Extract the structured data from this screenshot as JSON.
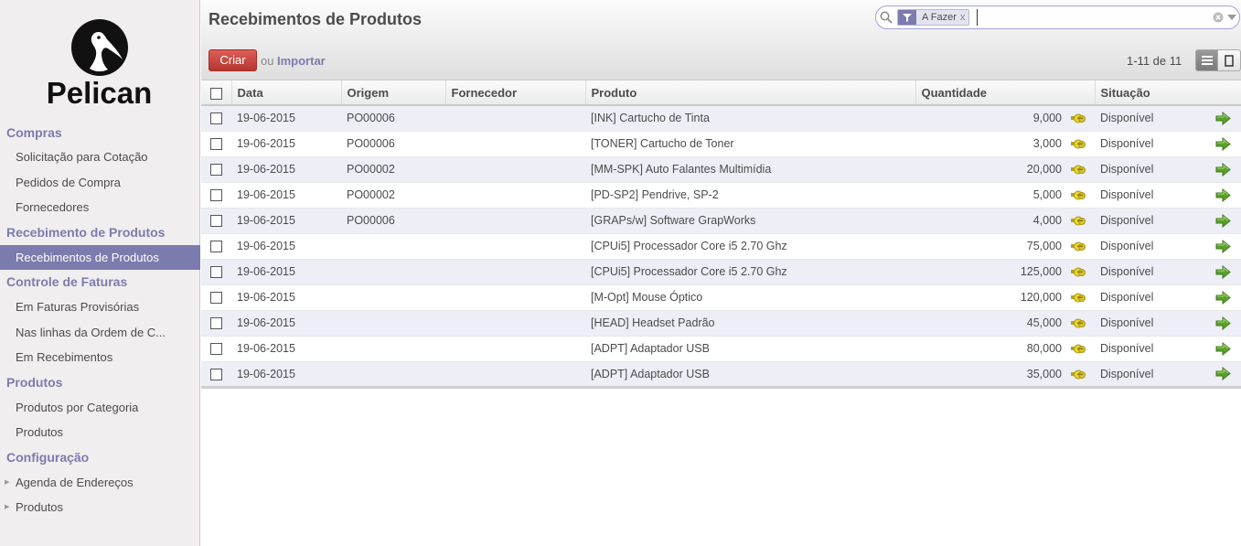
{
  "brand": {
    "name": "Pelican"
  },
  "sidebar": {
    "sections": [
      {
        "label": "Compras",
        "items": [
          {
            "label": "Solicitação para Cotação",
            "active": false,
            "caret": false
          },
          {
            "label": "Pedidos de Compra",
            "active": false,
            "caret": false
          },
          {
            "label": "Fornecedores",
            "active": false,
            "caret": false
          }
        ]
      },
      {
        "label": "Recebimento de Produtos",
        "items": [
          {
            "label": "Recebimentos de Produtos",
            "active": true,
            "caret": false
          }
        ]
      },
      {
        "label": "Controle de Faturas",
        "items": [
          {
            "label": "Em Faturas Provisórias",
            "active": false,
            "caret": false
          },
          {
            "label": "Nas linhas da Ordem de C...",
            "active": false,
            "caret": false
          },
          {
            "label": "Em Recebimentos",
            "active": false,
            "caret": false
          }
        ]
      },
      {
        "label": "Produtos",
        "items": [
          {
            "label": "Produtos por Categoria",
            "active": false,
            "caret": false
          },
          {
            "label": "Produtos",
            "active": false,
            "caret": false
          }
        ]
      },
      {
        "label": "Configuração",
        "items": [
          {
            "label": "Agenda de Endereços",
            "active": false,
            "caret": true
          },
          {
            "label": "Produtos",
            "active": false,
            "caret": true
          }
        ]
      }
    ]
  },
  "header": {
    "title": "Recebimentos de Produtos",
    "create_label": "Criar",
    "or_label": "ou",
    "import_label": "Importar",
    "pager": "1-11 de 11"
  },
  "search": {
    "facet_label": "A Fazer",
    "facet_close": "x",
    "query": ""
  },
  "table": {
    "columns": [
      "Data",
      "Origem",
      "Fornecedor",
      "Produto",
      "Quantidade",
      "Situação"
    ],
    "rows": [
      {
        "data": "19-06-2015",
        "origem": "PO00006",
        "fornecedor": "",
        "produto": "[INK] Cartucho de Tinta",
        "quantidade": "9,000",
        "situacao": "Disponível"
      },
      {
        "data": "19-06-2015",
        "origem": "PO00006",
        "fornecedor": "",
        "produto": "[TONER] Cartucho de Toner",
        "quantidade": "3,000",
        "situacao": "Disponível"
      },
      {
        "data": "19-06-2015",
        "origem": "PO00002",
        "fornecedor": "",
        "produto": "[MM-SPK] Auto Falantes Multimídia",
        "quantidade": "20,000",
        "situacao": "Disponível"
      },
      {
        "data": "19-06-2015",
        "origem": "PO00002",
        "fornecedor": "",
        "produto": "[PD-SP2] Pendrive, SP-2",
        "quantidade": "5,000",
        "situacao": "Disponível"
      },
      {
        "data": "19-06-2015",
        "origem": "PO00006",
        "fornecedor": "",
        "produto": "[GRAPs/w] Software GrapWorks",
        "quantidade": "4,000",
        "situacao": "Disponível"
      },
      {
        "data": "19-06-2015",
        "origem": "",
        "fornecedor": "",
        "produto": "[CPUi5] Processador Core i5 2.70 Ghz",
        "quantidade": "75,000",
        "situacao": "Disponível"
      },
      {
        "data": "19-06-2015",
        "origem": "",
        "fornecedor": "",
        "produto": "[CPUi5] Processador Core i5 2.70 Ghz",
        "quantidade": "125,000",
        "situacao": "Disponível"
      },
      {
        "data": "19-06-2015",
        "origem": "",
        "fornecedor": "",
        "produto": "[M-Opt] Mouse Óptico",
        "quantidade": "120,000",
        "situacao": "Disponível"
      },
      {
        "data": "19-06-2015",
        "origem": "",
        "fornecedor": "",
        "produto": "[HEAD] Headset Padrão",
        "quantidade": "45,000",
        "situacao": "Disponível"
      },
      {
        "data": "19-06-2015",
        "origem": "",
        "fornecedor": "",
        "produto": "[ADPT] Adaptador USB",
        "quantidade": "80,000",
        "situacao": "Disponível"
      },
      {
        "data": "19-06-2015",
        "origem": "",
        "fornecedor": "",
        "produto": "[ADPT] Adaptador USB",
        "quantidade": "35,000",
        "situacao": "Disponível"
      }
    ]
  },
  "icons": {
    "search": "search-icon",
    "filter": "filter-icon",
    "clear": "clear-search-icon",
    "list_view": "list-view-icon",
    "form_view": "form-view-icon",
    "split": "split-lot-icon",
    "process": "process-arrow-icon"
  },
  "colors": {
    "accent": "#7c7bad",
    "create_button": "#c5413b",
    "row_alt": "#eeeef7",
    "arrow_green": "#5aa02c"
  }
}
